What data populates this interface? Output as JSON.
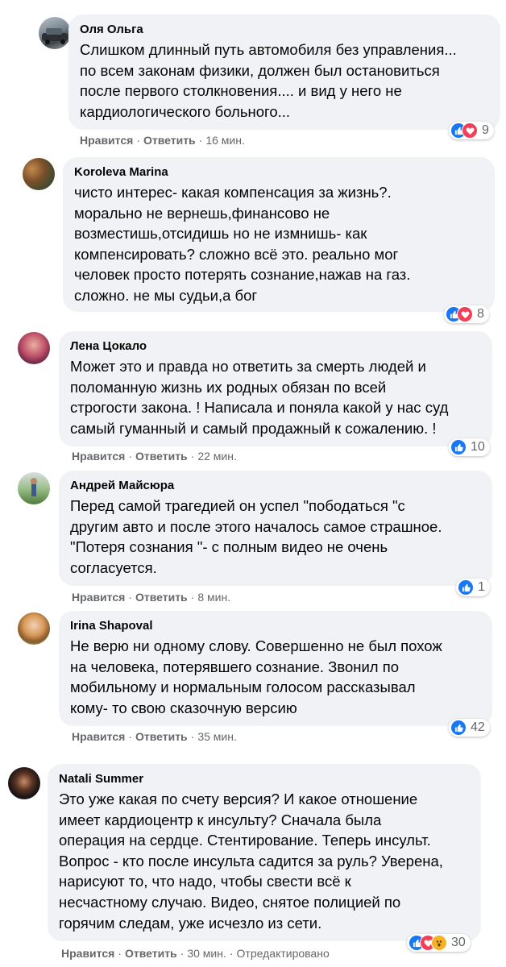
{
  "labels": {
    "like": "Нравится",
    "reply": "Ответить",
    "sep": "·"
  },
  "comments": [
    {
      "author": "Оля Ольга",
      "text": "Слишком длинный путь автомобиля без управления...\nпо всем законам физики, должен был остановиться\nпосле первого столкновения.... и вид у него не\nкардиологического больного...",
      "reaction_count": "9",
      "reactions": [
        "like",
        "love"
      ],
      "time": "16 мин.",
      "edited": ""
    },
    {
      "author": "Koroleva Marina",
      "text": "чисто интерес- какая компенсация за жизнь?.\nморально не вернешь,финансово не\nвозместишь,отсидишь но не измнишь- как\nкомпенсировать? сложно всё это. реально мог\nчеловек просто потерять сознание,нажав на газ.\nсложно. не мы судьи,а бог",
      "reaction_count": "8",
      "reactions": [
        "like",
        "love"
      ],
      "time": "",
      "edited": ""
    },
    {
      "author": "Лена Цокало",
      "text": "Может это и правда но ответить за смерть людей и\nполоманную жизнь их родных обязан по всей\nстрогости закона. ! Написала и поняла какой у нас суд\nсамый гуманный и самый продажный к сожалению. !",
      "reaction_count": "10",
      "reactions": [
        "like"
      ],
      "time": "22 мин.",
      "edited": ""
    },
    {
      "author": "Андрей Майсюра",
      "text": "Перед самой трагедией он успел \"пободаться \"с\nдругим авто и после этого началось самое страшное.\n\"Потеря сознания \"- с полным видео не очень\nсогласуется.",
      "reaction_count": "1",
      "reactions": [
        "like"
      ],
      "time": "8 мин.",
      "edited": ""
    },
    {
      "author": "Irina Shapoval",
      "text": "Не верю ни одному слову. Совершенно не был похож\nна человека, потерявшего сознание. Звонил по\nмобильному и нормальным голосом рассказывал\nкому- то свою сказочную версию",
      "reaction_count": "42",
      "reactions": [
        "like"
      ],
      "time": "35 мин.",
      "edited": ""
    },
    {
      "author": "Natali Summer",
      "text": "Это уже какая по счету версия? И какое отношение\nимеет кардиоцентр к инсульту? Сначала была\nоперация на сердце. Стентирование. Теперь инсульт.\nВопрос - кто после инсульта садится за руль? Уверена,\nнарисуют то, что надо, чтобы свести всё к\nнесчастному случаю. Видео, снятое полицией по\nгорячим следам, уже исчезло из сети.",
      "reaction_count": "30",
      "reactions": [
        "like",
        "love",
        "wow"
      ],
      "time": "30 мин.",
      "edited": "Отредактировано"
    }
  ],
  "colors": {
    "bubble": "#f0f2f5",
    "meta": "#65676b",
    "like": "#1877f2",
    "love": "#f33e58",
    "wow": "#f7b125"
  }
}
